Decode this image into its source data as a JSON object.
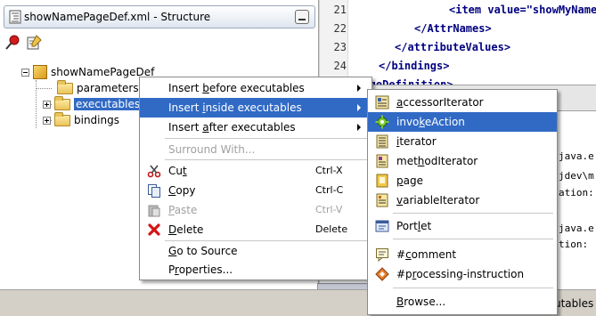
{
  "structure_panel": {
    "title": "showNamePageDef.xml - Structure",
    "tree": {
      "root": "showNamePageDef",
      "children": [
        "parameters",
        "executables",
        "bindings"
      ]
    }
  },
  "editor": {
    "lines": [
      {
        "num": "21",
        "text": "<item value=\"showMyName"
      },
      {
        "num": "22",
        "text": "</AttrNames>"
      },
      {
        "num": "23",
        "text": "</attributeValues>"
      },
      {
        "num": "24",
        "text": "</bindings>"
      },
      {
        "num": "",
        "text": "/pageDefinition>"
      }
    ],
    "log_fragments": [
      "java.e",
      "jdev\\m",
      "ation:",
      "java.e",
      "tion:"
    ]
  },
  "context_menu": {
    "items": [
      {
        "label": "Insert before executables",
        "mnemonic": "b"
      },
      {
        "label": "Insert inside executables",
        "mnemonic": "i"
      },
      {
        "label": "Insert after executables",
        "mnemonic": "a"
      },
      {
        "label": "Surround With..."
      },
      {
        "label": "Cut",
        "shortcut": "Ctrl-X"
      },
      {
        "label": "Copy",
        "shortcut": "Ctrl-C"
      },
      {
        "label": "Paste",
        "shortcut": "Ctrl-V"
      },
      {
        "label": "Delete",
        "shortcut": "Delete"
      },
      {
        "label": "Go to Source"
      },
      {
        "label": "Properties..."
      }
    ]
  },
  "submenu": {
    "items": [
      {
        "label": "accessorIterator",
        "icon": "accessor-iterator-icon"
      },
      {
        "label": "invokeAction",
        "icon": "invoke-action-gear-icon"
      },
      {
        "label": "iterator",
        "icon": "iterator-icon"
      },
      {
        "label": "methodIterator",
        "icon": "method-iterator-icon"
      },
      {
        "label": "page",
        "icon": "page-icon"
      },
      {
        "label": "variableIterator",
        "icon": "variable-iterator-icon"
      },
      {
        "label": "Portlet",
        "icon": "portlet-icon"
      },
      {
        "label": "#comment",
        "icon": "comment-icon"
      },
      {
        "label": "#processing-instruction",
        "icon": "processing-instruction-icon"
      },
      {
        "label": "Browse..."
      }
    ]
  },
  "status_bar": {
    "text": "utables"
  },
  "colors": {
    "selection": "#316ac5",
    "menu_bg": "#ffffff",
    "window_bg": "#d4d0c8"
  }
}
